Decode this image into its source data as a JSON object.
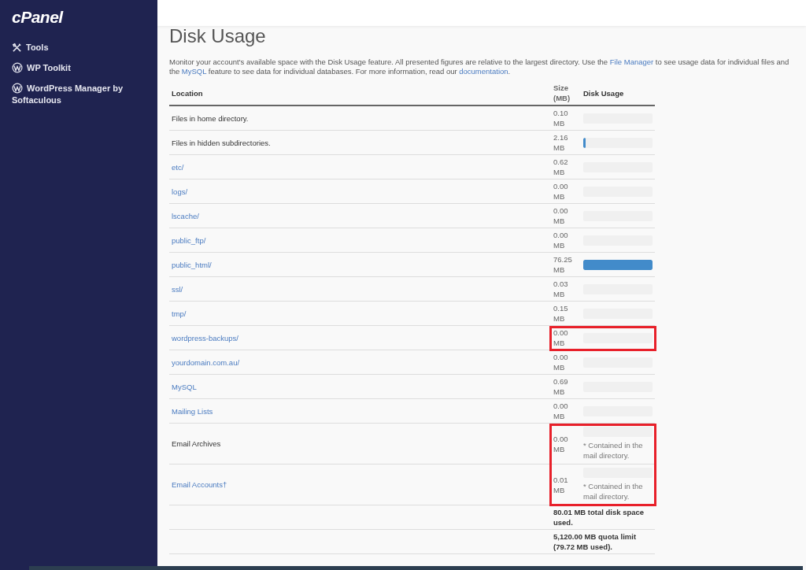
{
  "sidebar": {
    "logo": "cPanel",
    "items": [
      {
        "label": "Tools"
      },
      {
        "label": "WP Toolkit"
      },
      {
        "label": "WordPress Manager by Softaculous"
      }
    ]
  },
  "page": {
    "title": "Disk Usage",
    "intro": [
      {
        "kind": "text",
        "text": "Monitor your account's available space with the Disk Usage feature. All presented figures are relative to the largest directory. Use the "
      },
      {
        "kind": "link",
        "text": "File Manager"
      },
      {
        "kind": "text",
        "text": " to see usage data for individual files and the "
      },
      {
        "kind": "link",
        "text": "MySQL"
      },
      {
        "kind": "text",
        "text": " feature to see data for individual databases. For more information, read our "
      },
      {
        "kind": "link",
        "text": "documentation"
      },
      {
        "kind": "text",
        "text": "."
      }
    ]
  },
  "table": {
    "columns": [
      "Location",
      "Size (MB)",
      "Disk Usage"
    ],
    "rows": [
      {
        "location": "Files in home directory.",
        "kind": "text",
        "size": "0.10 MB",
        "level": 0,
        "highlighted": false
      },
      {
        "location": "Files in hidden subdirectories.",
        "kind": "text",
        "size": "2.16 MB",
        "level": 0.03,
        "highlighted": false
      },
      {
        "location": "etc/",
        "kind": "link",
        "size": "0.62 MB",
        "level": 0,
        "highlighted": false
      },
      {
        "location": "logs/",
        "kind": "link",
        "size": "0.00 MB",
        "level": 0,
        "highlighted": false
      },
      {
        "location": "lscache/",
        "kind": "link",
        "size": "0.00 MB",
        "level": 0,
        "highlighted": false
      },
      {
        "location": "public_ftp/",
        "kind": "link",
        "size": "0.00 MB",
        "level": 0,
        "highlighted": false
      },
      {
        "location": "public_html/",
        "kind": "link",
        "size": "76.25 MB",
        "level": 1,
        "highlighted": false
      },
      {
        "location": "ssl/",
        "kind": "link",
        "size": "0.03 MB",
        "level": 0,
        "highlighted": false
      },
      {
        "location": "tmp/",
        "kind": "link",
        "size": "0.15 MB",
        "level": 0,
        "highlighted": false
      },
      {
        "location": "wordpress-backups/",
        "kind": "link",
        "size": "0.00 MB",
        "level": 0,
        "highlighted": true
      },
      {
        "location": "yourdomain.com.au/",
        "kind": "link",
        "size": "0.00 MB",
        "level": 0,
        "highlighted": false
      },
      {
        "location": "MySQL",
        "kind": "link",
        "size": "0.69 MB",
        "level": 0,
        "highlighted": false
      },
      {
        "location": "Mailing Lists",
        "kind": "link",
        "size": "0.00 MB",
        "level": 0,
        "highlighted": false
      },
      {
        "location": "Email Archives",
        "kind": "text",
        "size": "0.00 MB",
        "level": 0,
        "note": "* Contained in the mail directory.",
        "highlighted": true
      },
      {
        "location": "Email Accounts†",
        "kind": "link",
        "size": "0.01 MB",
        "level": 0,
        "note": "* Contained in the mail directory.",
        "highlighted": true
      }
    ],
    "totals": [
      "80.01 MB total disk space used.",
      "5,120.00 MB quota limit (79.72 MB used)."
    ]
  }
}
